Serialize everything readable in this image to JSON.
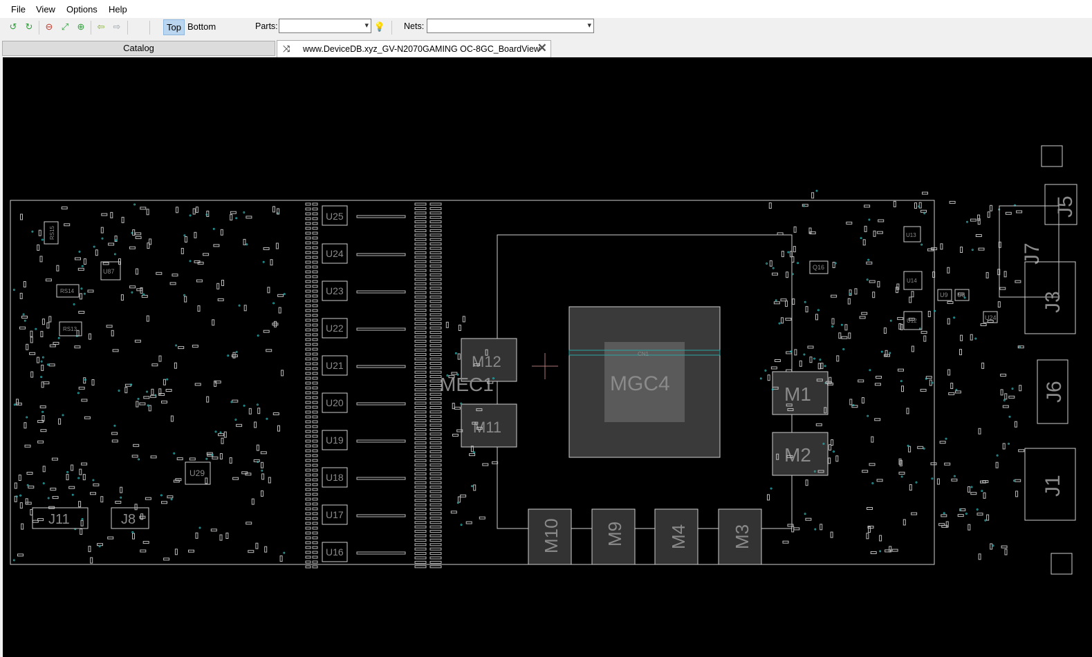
{
  "menu": [
    "File",
    "View",
    "Options",
    "Help"
  ],
  "toolbar": {
    "icons": [
      "rotate-left-icon",
      "rotate-right-icon",
      "zoom-out-icon",
      "zoom-fit-icon",
      "zoom-in-icon",
      "back-arrow-icon",
      "forward-arrow-icon"
    ],
    "layer_top": "Top",
    "layer_bottom": "Bottom",
    "parts_label": "Parts:",
    "parts_value": "",
    "nets_label": "Nets:",
    "nets_value": "",
    "highlight_icon": "lightbulb-icon"
  },
  "tabs": {
    "catalog": "Catalog",
    "board": "www.DeviceDB.xyz_GV-N2070GAMING OC-8GC_BoardView"
  },
  "board": {
    "background": "#000000",
    "outline_color": "#d9d9d9",
    "accent": "#2aa5a5",
    "components": [
      {
        "label": "U25"
      },
      {
        "label": "U24"
      },
      {
        "label": "U23"
      },
      {
        "label": "U22"
      },
      {
        "label": "U21"
      },
      {
        "label": "U20"
      },
      {
        "label": "U19"
      },
      {
        "label": "U18"
      },
      {
        "label": "U17"
      },
      {
        "label": "U16"
      },
      {
        "label": "M12"
      },
      {
        "label": "M11"
      },
      {
        "label": "MEC1"
      },
      {
        "label": "MGC4"
      },
      {
        "label": "CN1"
      },
      {
        "label": "M1"
      },
      {
        "label": "M2"
      },
      {
        "label": "M10"
      },
      {
        "label": "M9"
      },
      {
        "label": "M4"
      },
      {
        "label": "M3"
      },
      {
        "label": "J11"
      },
      {
        "label": "J8"
      },
      {
        "label": "J7"
      },
      {
        "label": "J5"
      },
      {
        "label": "J3"
      },
      {
        "label": "J6"
      },
      {
        "label": "J1"
      },
      {
        "label": "RS15"
      },
      {
        "label": "RS14"
      },
      {
        "label": "RS13"
      },
      {
        "label": "U87"
      },
      {
        "label": "U29"
      },
      {
        "label": "Q16"
      },
      {
        "label": "U14"
      },
      {
        "label": "U13"
      },
      {
        "label": "U12"
      },
      {
        "label": "U9"
      },
      {
        "label": "U6"
      },
      {
        "label": "U24"
      }
    ]
  }
}
